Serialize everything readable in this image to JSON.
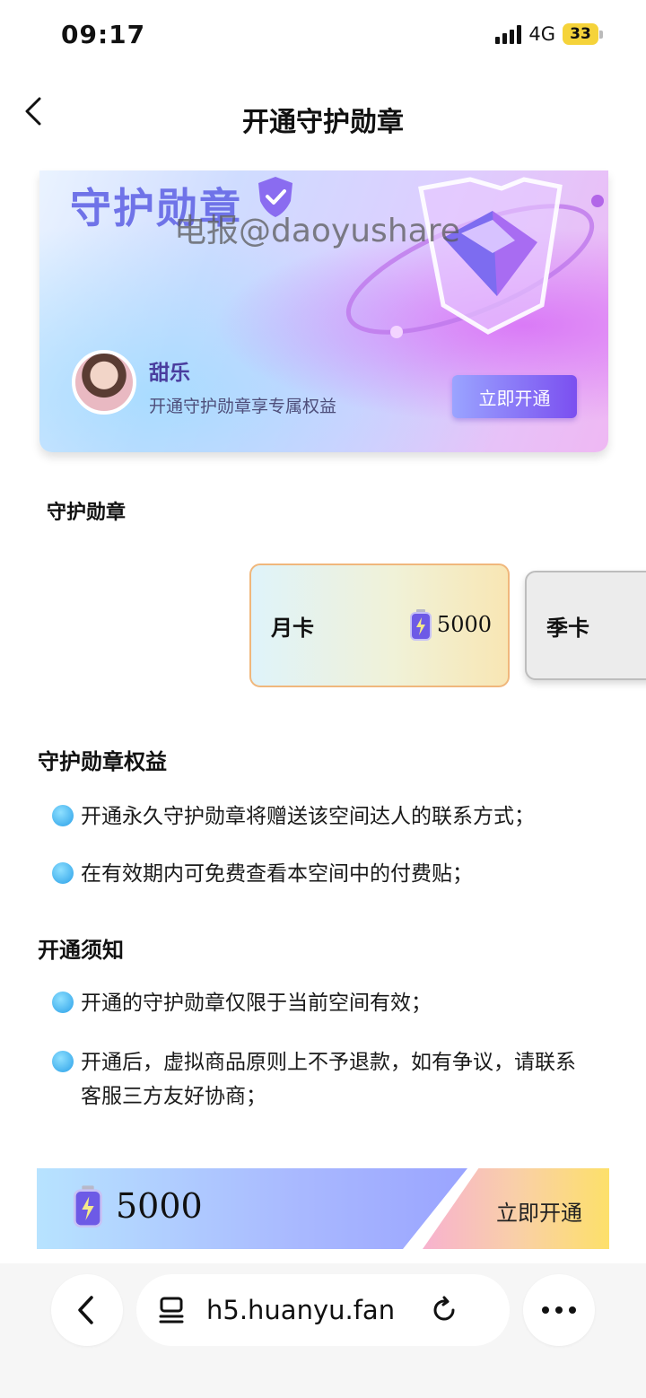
{
  "status_bar": {
    "time": "09:17",
    "network": "4G",
    "battery": "33"
  },
  "nav": {
    "title": "开通守护勋章",
    "back_icon": "chevron-left-icon"
  },
  "banner": {
    "title": "守护勋章",
    "watermark": "电报@daoyushare",
    "user_name": "甜乐",
    "user_desc": "开通守护勋章享专属权益",
    "button_label": "立即开通",
    "colors": {
      "title": "#6f73e8",
      "button": "#7b4ff0"
    }
  },
  "section_label": "守护勋章",
  "plans": [
    {
      "name": "月卡",
      "price": "5000",
      "selected": true
    },
    {
      "name": "季卡",
      "selected": false
    }
  ],
  "benefits": {
    "title": "守护勋章权益",
    "items": [
      "开通永久守护勋章将赠送该空间达人的联系方式；",
      "在有效期内可免费查看本空间中的付费贴；"
    ]
  },
  "notice": {
    "title": "开通须知",
    "items": [
      "开通的守护勋章仅限于当前空间有效；",
      "开通后，虚拟商品原则上不予退款，如有争议，请联系客服三方友好协商；"
    ]
  },
  "pay_bar": {
    "amount": "5000",
    "button_label": "立即开通"
  },
  "browser": {
    "url": "h5.huanyu.fan"
  }
}
